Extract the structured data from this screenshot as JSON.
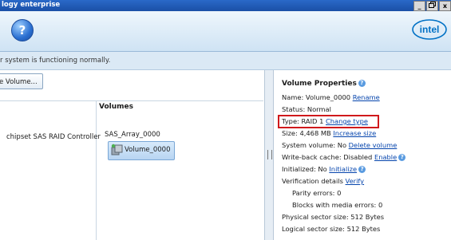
{
  "window": {
    "title": "logy enterprise",
    "controls": [
      "_",
      "3",
      "x"
    ]
  },
  "banner": {
    "help_glyph": "?",
    "logo_text": "intel"
  },
  "status": {
    "message": "r system is functioning normally."
  },
  "left": {
    "create_button": "e Volume...",
    "volumes_heading": "Volumes",
    "controller": "chipset SAS RAID Controller",
    "array": "SAS_Array_0000",
    "volume": "Volume_0000"
  },
  "props": {
    "title": "Volume Properties",
    "name_label": "Name: Volume_0000",
    "rename": "Rename",
    "status": "Status: Normal",
    "type_label": "Type: RAID 1",
    "change_type": "Change type",
    "size_label": "Size: 4,468 MB",
    "increase_size": "Increase size",
    "system_label": "System volume: No",
    "delete_volume": "Delete volume",
    "cache_label": "Write-back cache: Disabled",
    "enable": "Enable",
    "init_label": "Initialized: No",
    "initialize": "Initialize",
    "verif_label": "Verification details",
    "verify": "Verify",
    "parity": "Parity errors: 0",
    "blocks": "Blocks with media errors: 0",
    "physical": "Physical sector size: 512 Bytes",
    "logical": "Logical sector size: 512 Bytes"
  },
  "colors": {
    "highlight": "#d0191c",
    "link": "#0645ad",
    "accent": "#2a69c8"
  }
}
